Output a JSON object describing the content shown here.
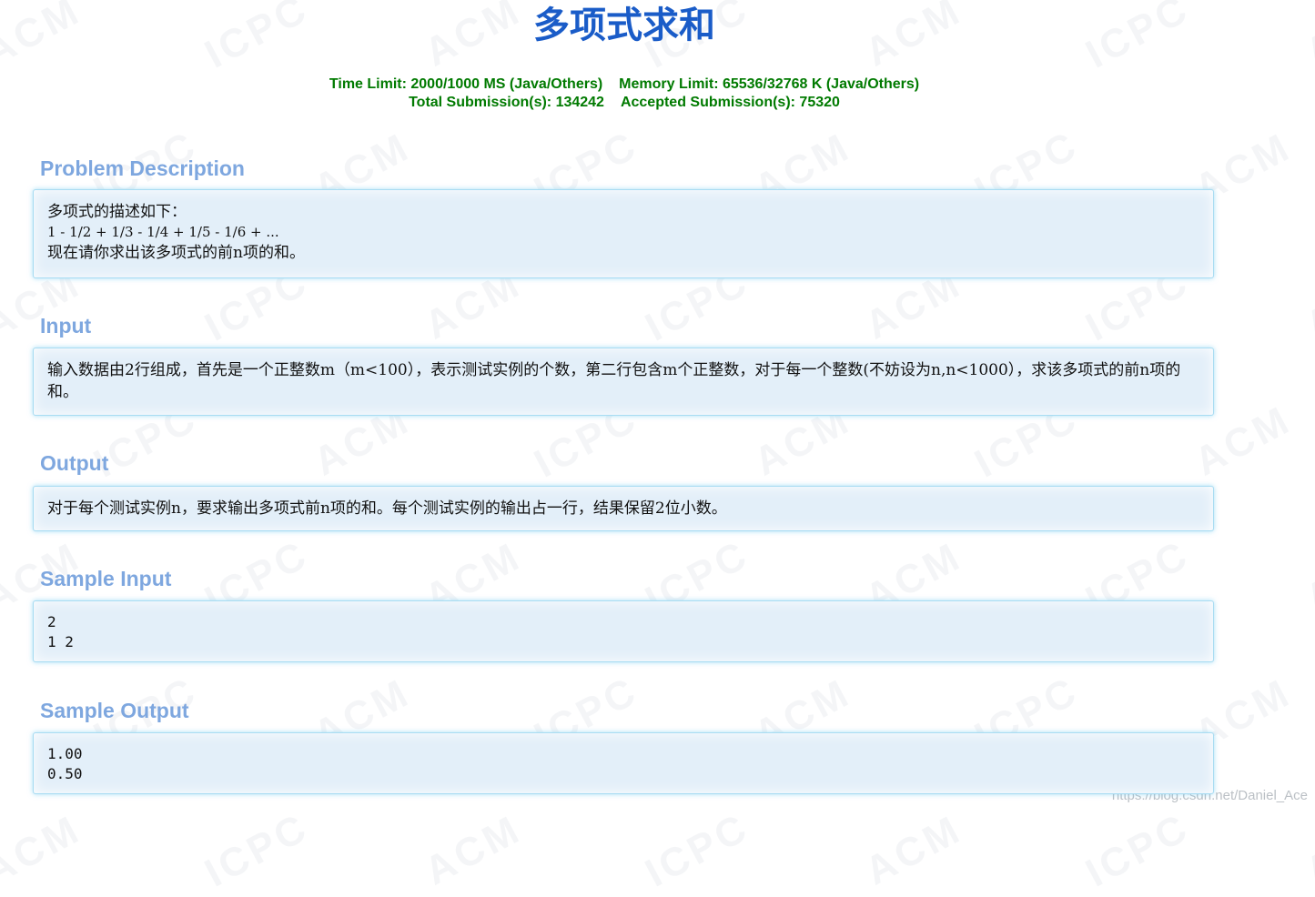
{
  "problem": {
    "title": "多项式求和",
    "limits": {
      "time_limit": "Time Limit: 2000/1000 MS (Java/Others)",
      "memory_limit": "Memory Limit: 65536/32768 K (Java/Others)",
      "total_submissions": "Total Submission(s): 134242",
      "accepted_submissions": "Accepted Submission(s): 75320"
    }
  },
  "sections": {
    "description": {
      "title": "Problem Description",
      "line1": "多项式的描述如下：",
      "line2": "1 - 1/2 + 1/3 - 1/4 + 1/5 - 1/6 + ...",
      "line3": "现在请你求出该多项式的前n项的和。"
    },
    "input": {
      "title": "Input",
      "text": "输入数据由2行组成，首先是一个正整数m（m<100），表示测试实例的个数，第二行包含m个正整数，对于每一个整数(不妨设为n,n<1000），求该多项式的前n项的和。"
    },
    "output": {
      "title": "Output",
      "text": "对于每个测试实例n，要求输出多项式前n项的和。每个测试实例的输出占一行，结果保留2位小数。"
    },
    "sample_input": {
      "title": "Sample Input",
      "lines": [
        "2",
        "1 2"
      ]
    },
    "sample_output": {
      "title": "Sample Output",
      "lines": [
        "1.00",
        "0.50"
      ]
    }
  },
  "watermark": {
    "words": [
      "ACM",
      "ICPC"
    ],
    "footer": "https://blog.csdn.net/Daniel_Ace"
  },
  "colors": {
    "title": "#1a5cc8",
    "limits": "#007a00",
    "section_title": "#7ea7df",
    "panel_bg": "#e3eff9",
    "panel_border": "#a8dcf2"
  }
}
